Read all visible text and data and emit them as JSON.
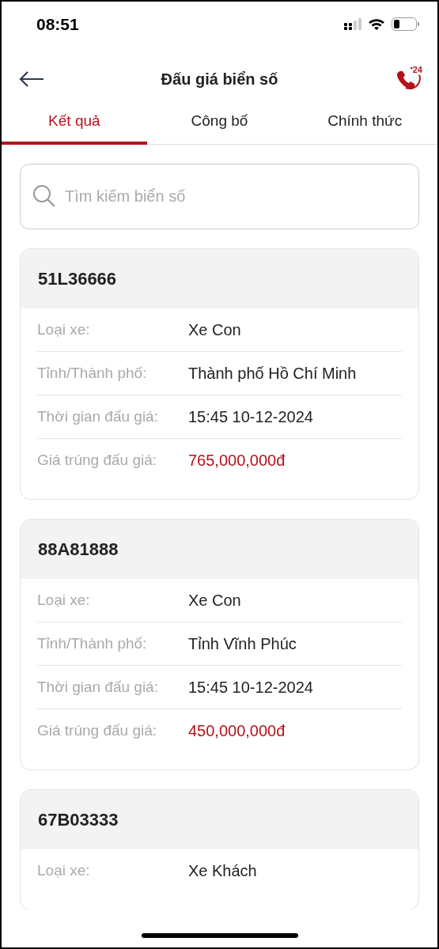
{
  "status_bar": {
    "time": "08:51"
  },
  "header": {
    "title": "Đấu giá biển số",
    "hotline_badge": "24"
  },
  "tabs": [
    {
      "label": "Kết quả",
      "selected": true
    },
    {
      "label": "Công bố",
      "selected": false
    },
    {
      "label": "Chính thức",
      "selected": false
    }
  ],
  "search": {
    "placeholder": "Tìm kiếm biển số"
  },
  "results": [
    {
      "plate": "51L36666",
      "rows": [
        {
          "label": "Loại xe:",
          "value": "Xe Con",
          "kind": "plain"
        },
        {
          "label": "Tỉnh/Thành phố:",
          "value": "Thành phố Hồ Chí Minh",
          "kind": "plain"
        },
        {
          "label": "Thời gian đấu giá:",
          "value": "15:45 10-12-2024",
          "kind": "plain"
        },
        {
          "label": "Giá trúng đấu giá:",
          "value": "765,000,000đ",
          "kind": "price"
        }
      ]
    },
    {
      "plate": "88A81888",
      "rows": [
        {
          "label": "Loại xe:",
          "value": "Xe Con",
          "kind": "plain"
        },
        {
          "label": "Tỉnh/Thành phố:",
          "value": "Tỉnh Vĩnh Phúc",
          "kind": "plain"
        },
        {
          "label": "Thời gian đấu giá:",
          "value": "15:45 10-12-2024",
          "kind": "plain"
        },
        {
          "label": "Giá trúng đấu giá:",
          "value": "450,000,000đ",
          "kind": "price"
        }
      ]
    },
    {
      "plate": "67B03333",
      "rows": [
        {
          "label": "Loại xe:",
          "value": "Xe Khách",
          "kind": "plain"
        }
      ]
    }
  ]
}
